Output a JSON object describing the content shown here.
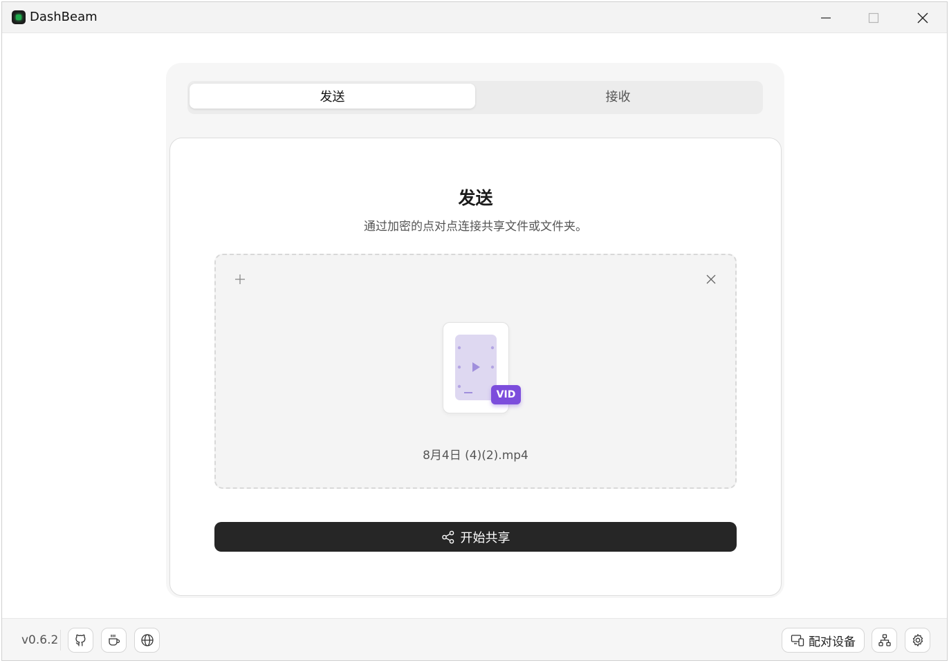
{
  "window": {
    "title": "DashBeam",
    "controls": [
      "minimize-icon",
      "maximize-icon",
      "close-icon"
    ]
  },
  "tabs": [
    {
      "label": "发送",
      "active": true
    },
    {
      "label": "接收",
      "active": false
    }
  ],
  "send_card": {
    "title": "发送",
    "subtitle": "通过加密的点对点连接共享文件或文件夹。",
    "dropzone": {
      "add_icon": "plus-icon",
      "clear_icon": "close-icon",
      "file": {
        "name": "8月4日 (4)(2).mp4",
        "badge": "VID",
        "icon": "video-file-icon"
      }
    },
    "primary_button": {
      "label": "开始共享",
      "icon": "share-icon"
    }
  },
  "footer": {
    "version": "v0.6.2",
    "left_buttons": [
      "github-icon",
      "coffee-icon",
      "globe-icon"
    ],
    "pair_button": {
      "label": "配对设备",
      "icon": "devices-icon"
    },
    "right_buttons": [
      "network-icon",
      "settings-icon"
    ]
  },
  "colors": {
    "accent_badge": "#7c4ddc",
    "primary_button": "#262626",
    "video_tile": "#ded8f1"
  }
}
